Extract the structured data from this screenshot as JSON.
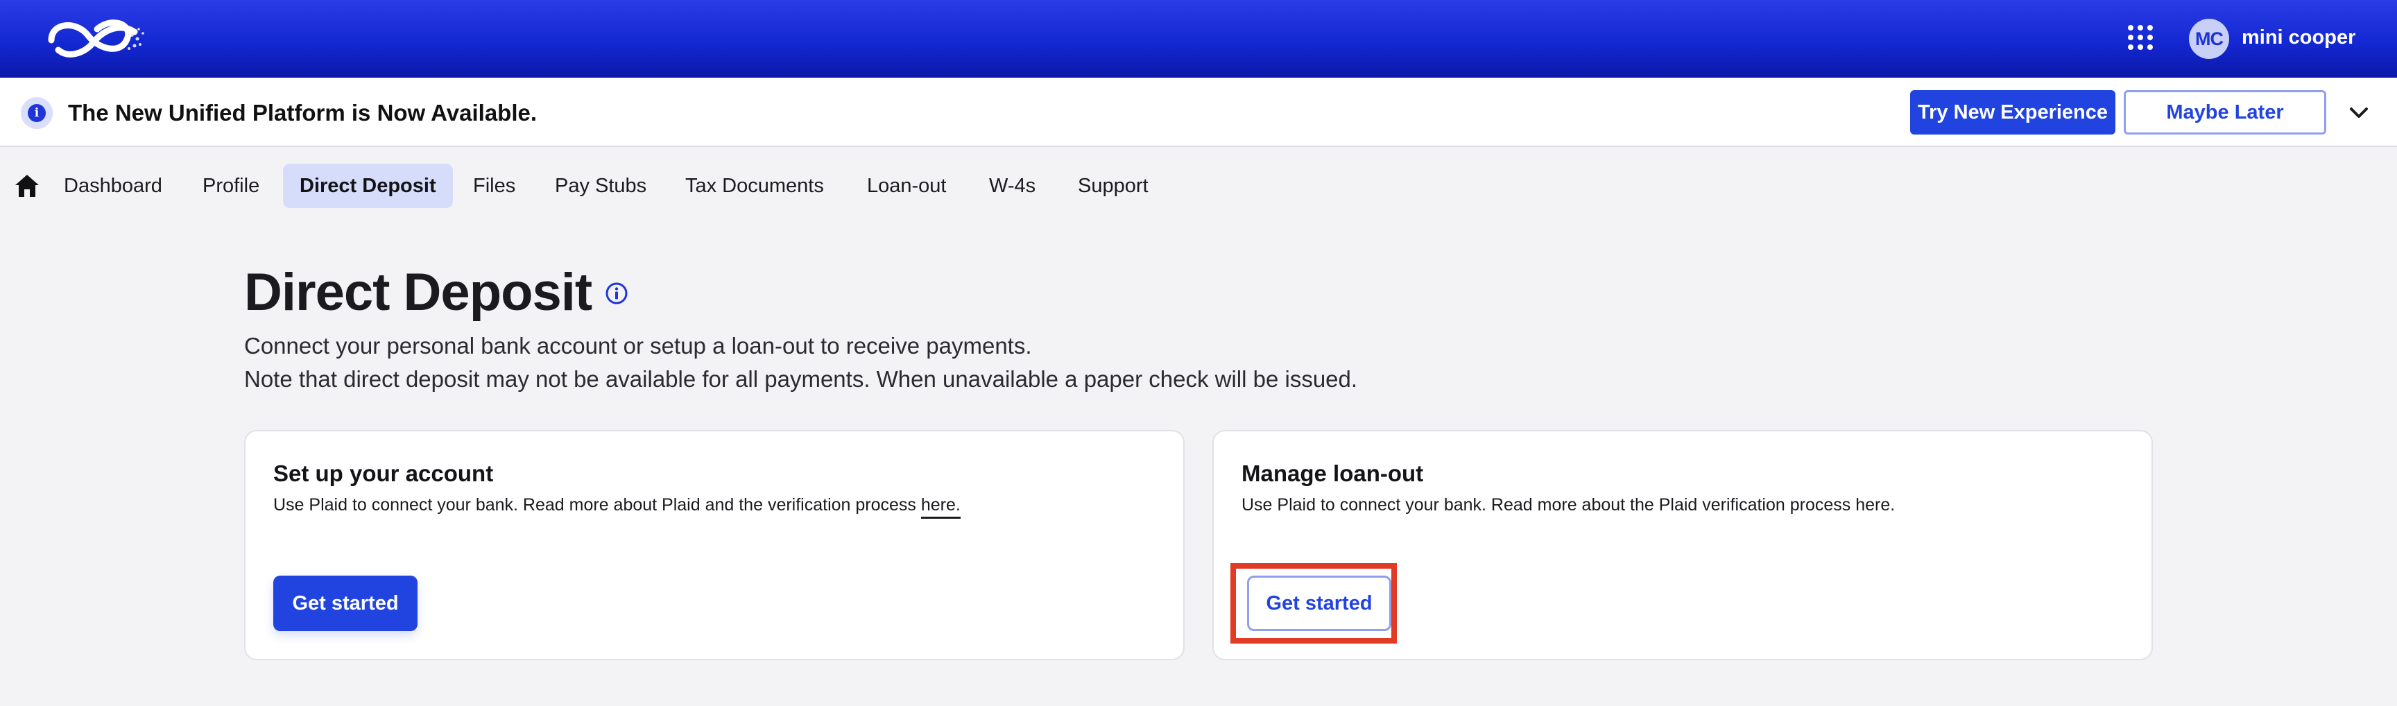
{
  "header": {
    "user_initials": "MC",
    "user_name": "mini cooper",
    "icons": [
      "logo",
      "apps-grid-icon"
    ]
  },
  "banner": {
    "message": "The New Unified Platform is Now Available.",
    "try_label": "Try New Experience",
    "later_label": "Maybe Later",
    "icons": [
      "info-icon",
      "chevron-down-icon"
    ]
  },
  "nav": {
    "items": [
      {
        "label": "Dashboard"
      },
      {
        "label": "Profile"
      },
      {
        "label": "Direct Deposit",
        "active": true
      },
      {
        "label": "Files"
      },
      {
        "label": "Pay Stubs"
      },
      {
        "label": "Tax Documents"
      },
      {
        "label": "Loan-out"
      },
      {
        "label": "W-4s"
      },
      {
        "label": "Support"
      }
    ]
  },
  "main": {
    "title": "Direct Deposit",
    "intro": [
      "Connect your personal bank account or setup a loan-out to receive payments.",
      "Note that direct deposit may not be available for all payments. When unavailable a paper check will be issued."
    ],
    "cards": [
      {
        "title": "Set up your account",
        "desc_prefix": "Use Plaid to connect your bank. Read more about Plaid and the verification process ",
        "link_text": "here.",
        "button_label": "Get started"
      },
      {
        "title": "Manage loan-out",
        "desc": "Use Plaid to connect your bank. Read more about the Plaid verification process here.",
        "button_label": "Get started",
        "highlighted": true
      }
    ]
  },
  "colors": {
    "brand_blue": "#2144e0",
    "header_gradient_top": "#2a3ce6",
    "header_gradient_bottom": "#0a18a8",
    "active_tab_bg": "#d5ddfb",
    "highlight_red": "#e23b25"
  }
}
